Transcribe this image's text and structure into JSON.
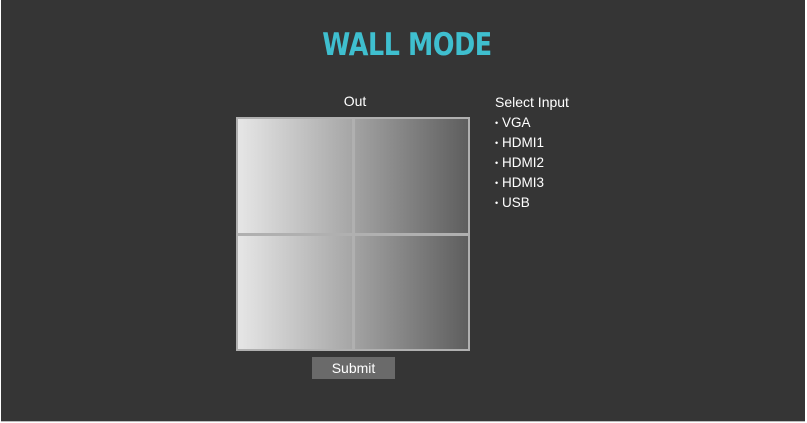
{
  "page": {
    "title": "WALL MODE"
  },
  "wall": {
    "out_label": "Out",
    "cells": [
      "",
      "",
      "",
      ""
    ]
  },
  "actions": {
    "submit_label": "Submit"
  },
  "inputs": {
    "title": "Select Input",
    "bullet": "•",
    "options": [
      "VGA",
      "HDMI1",
      "HDMI2",
      "HDMI3",
      "USB"
    ]
  },
  "colors": {
    "background": "#353535",
    "title": "#3fbfcf",
    "text": "#ffffff",
    "grid_border": "#b0b0b0",
    "button": "#6a6a6a"
  }
}
